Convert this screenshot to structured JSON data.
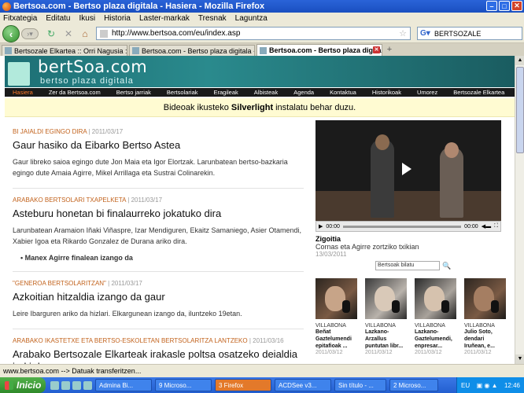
{
  "window": {
    "title": "Bertsoa.com - Bertso plaza digitala - Hasiera - Mozilla Firefox"
  },
  "menu": [
    "Fitxategia",
    "Editatu",
    "Ikusi",
    "Historia",
    "Laster-markak",
    "Tresnak",
    "Laguntza"
  ],
  "nav": {
    "url": "http://www.bertsoa.com/eu/index.asp",
    "search_value": "BERTSOZALE"
  },
  "tabs": [
    {
      "label": "Bertsozale Elkartea :: Orri Nagusia ::",
      "active": false
    },
    {
      "label": "Bertsoa.com - Bertso plaza digitala - Ze...",
      "active": false
    },
    {
      "label": "Bertsoa.com - Bertso plaza digita...",
      "active": true
    }
  ],
  "site": {
    "logo_name": "bertSoa.com",
    "logo_tag": "bertso plaza digitala",
    "nav": [
      "Hasiera",
      "Zer da Bertsoa.com",
      "Bertso jarriak",
      "Bertsolariak",
      "Eragileak",
      "Albisteak",
      "Agenda",
      "Kontaktua",
      "Historikoak",
      "Umorez",
      "Bertsozale Elkartea"
    ],
    "banner": {
      "before": "Bideoak ikusteko",
      "bold": "Silverlight",
      "after": "instalatu behar duzu."
    }
  },
  "articles": [
    {
      "kicker": "BI JAIALDI EGINGO DIRA",
      "date": "2011/03/17",
      "headline": "Gaur hasiko da Eibarko Bertso Astea",
      "summary": "Gaur libreko saioa egingo dute Jon Maia eta Igor Elortzak. Larunbatean bertso-bazkaria egingo dute Amaia Agirre, Mikel Arrillaga eta Sustrai Colinarekin.",
      "bullet": ""
    },
    {
      "kicker": "ARABAKO BERTSOLARI TXAPELKETA",
      "date": "2011/03/17",
      "headline": "Asteburu honetan bi finalaurreko jokatuko dira",
      "summary": "Larunbatean Aramaion Iñaki Viñaspre, Izar Mendiguren, Ekaitz Samaniego, Asier Otamendi, Xabier Igoa eta Rikardo Gonzalez de Durana ariko dira.",
      "bullet": "Manex Agirre finalean izango da"
    },
    {
      "kicker": "\"GENEROA BERTSOLARITZAN\"",
      "date": "2011/03/17",
      "headline": "Azkoitian hitzaldia izango da gaur",
      "summary": "Leire Ibarguren ariko da hizlari. Elkargunean izango da, iluntzeko 19etan.",
      "bullet": ""
    },
    {
      "kicker": "ARABAKO IKASTETXE ETA BERTSO-ESKOLETAN BERTSOLARITZA LANTZEKO",
      "date": "2011/03/16",
      "headline": "Arabako Bertsozale Elkarteak irakasle poltsa osatzeko deialdia ireki du",
      "summary": "",
      "bullet": ""
    }
  ],
  "video": {
    "time_current": "00:00",
    "time_total": "00:00",
    "title": "Zigoitia",
    "subtitle": "Cornas eta Agirre zortziko txikian",
    "date": "13/03/2011",
    "search_placeholder": "Bertsoak bilatu"
  },
  "thumbs": [
    {
      "place": "VILLABONA",
      "name": "Beñat Gaztelumendi epitafioak ...",
      "date": "2011/03/12"
    },
    {
      "place": "VILLABONA",
      "name": "Lazkano-Arzallus puntutan libr...",
      "date": "2011/03/12"
    },
    {
      "place": "VILLABONA",
      "name": "Lazkano-Gaztelumendi, enpresar...",
      "date": "2011/03/12"
    },
    {
      "place": "VILLABONA",
      "name": "Julio Soto, dendari Iruñean, e...",
      "date": "2011/03/12"
    }
  ],
  "status": "www.bertsoa.com --> Datuak transferitzen...",
  "taskbar": {
    "start": "Inicio",
    "tasks": [
      {
        "label": "Admina Bi...",
        "active": false
      },
      {
        "label": "9 Microso...",
        "active": false
      },
      {
        "label": "3 Firefox",
        "active": true
      },
      {
        "label": "ACDSee v3...",
        "active": false
      },
      {
        "label": "Sin título - ...",
        "active": false
      },
      {
        "label": "2 Microso...",
        "active": false
      }
    ],
    "lang": "EU",
    "clock": "12:46"
  }
}
